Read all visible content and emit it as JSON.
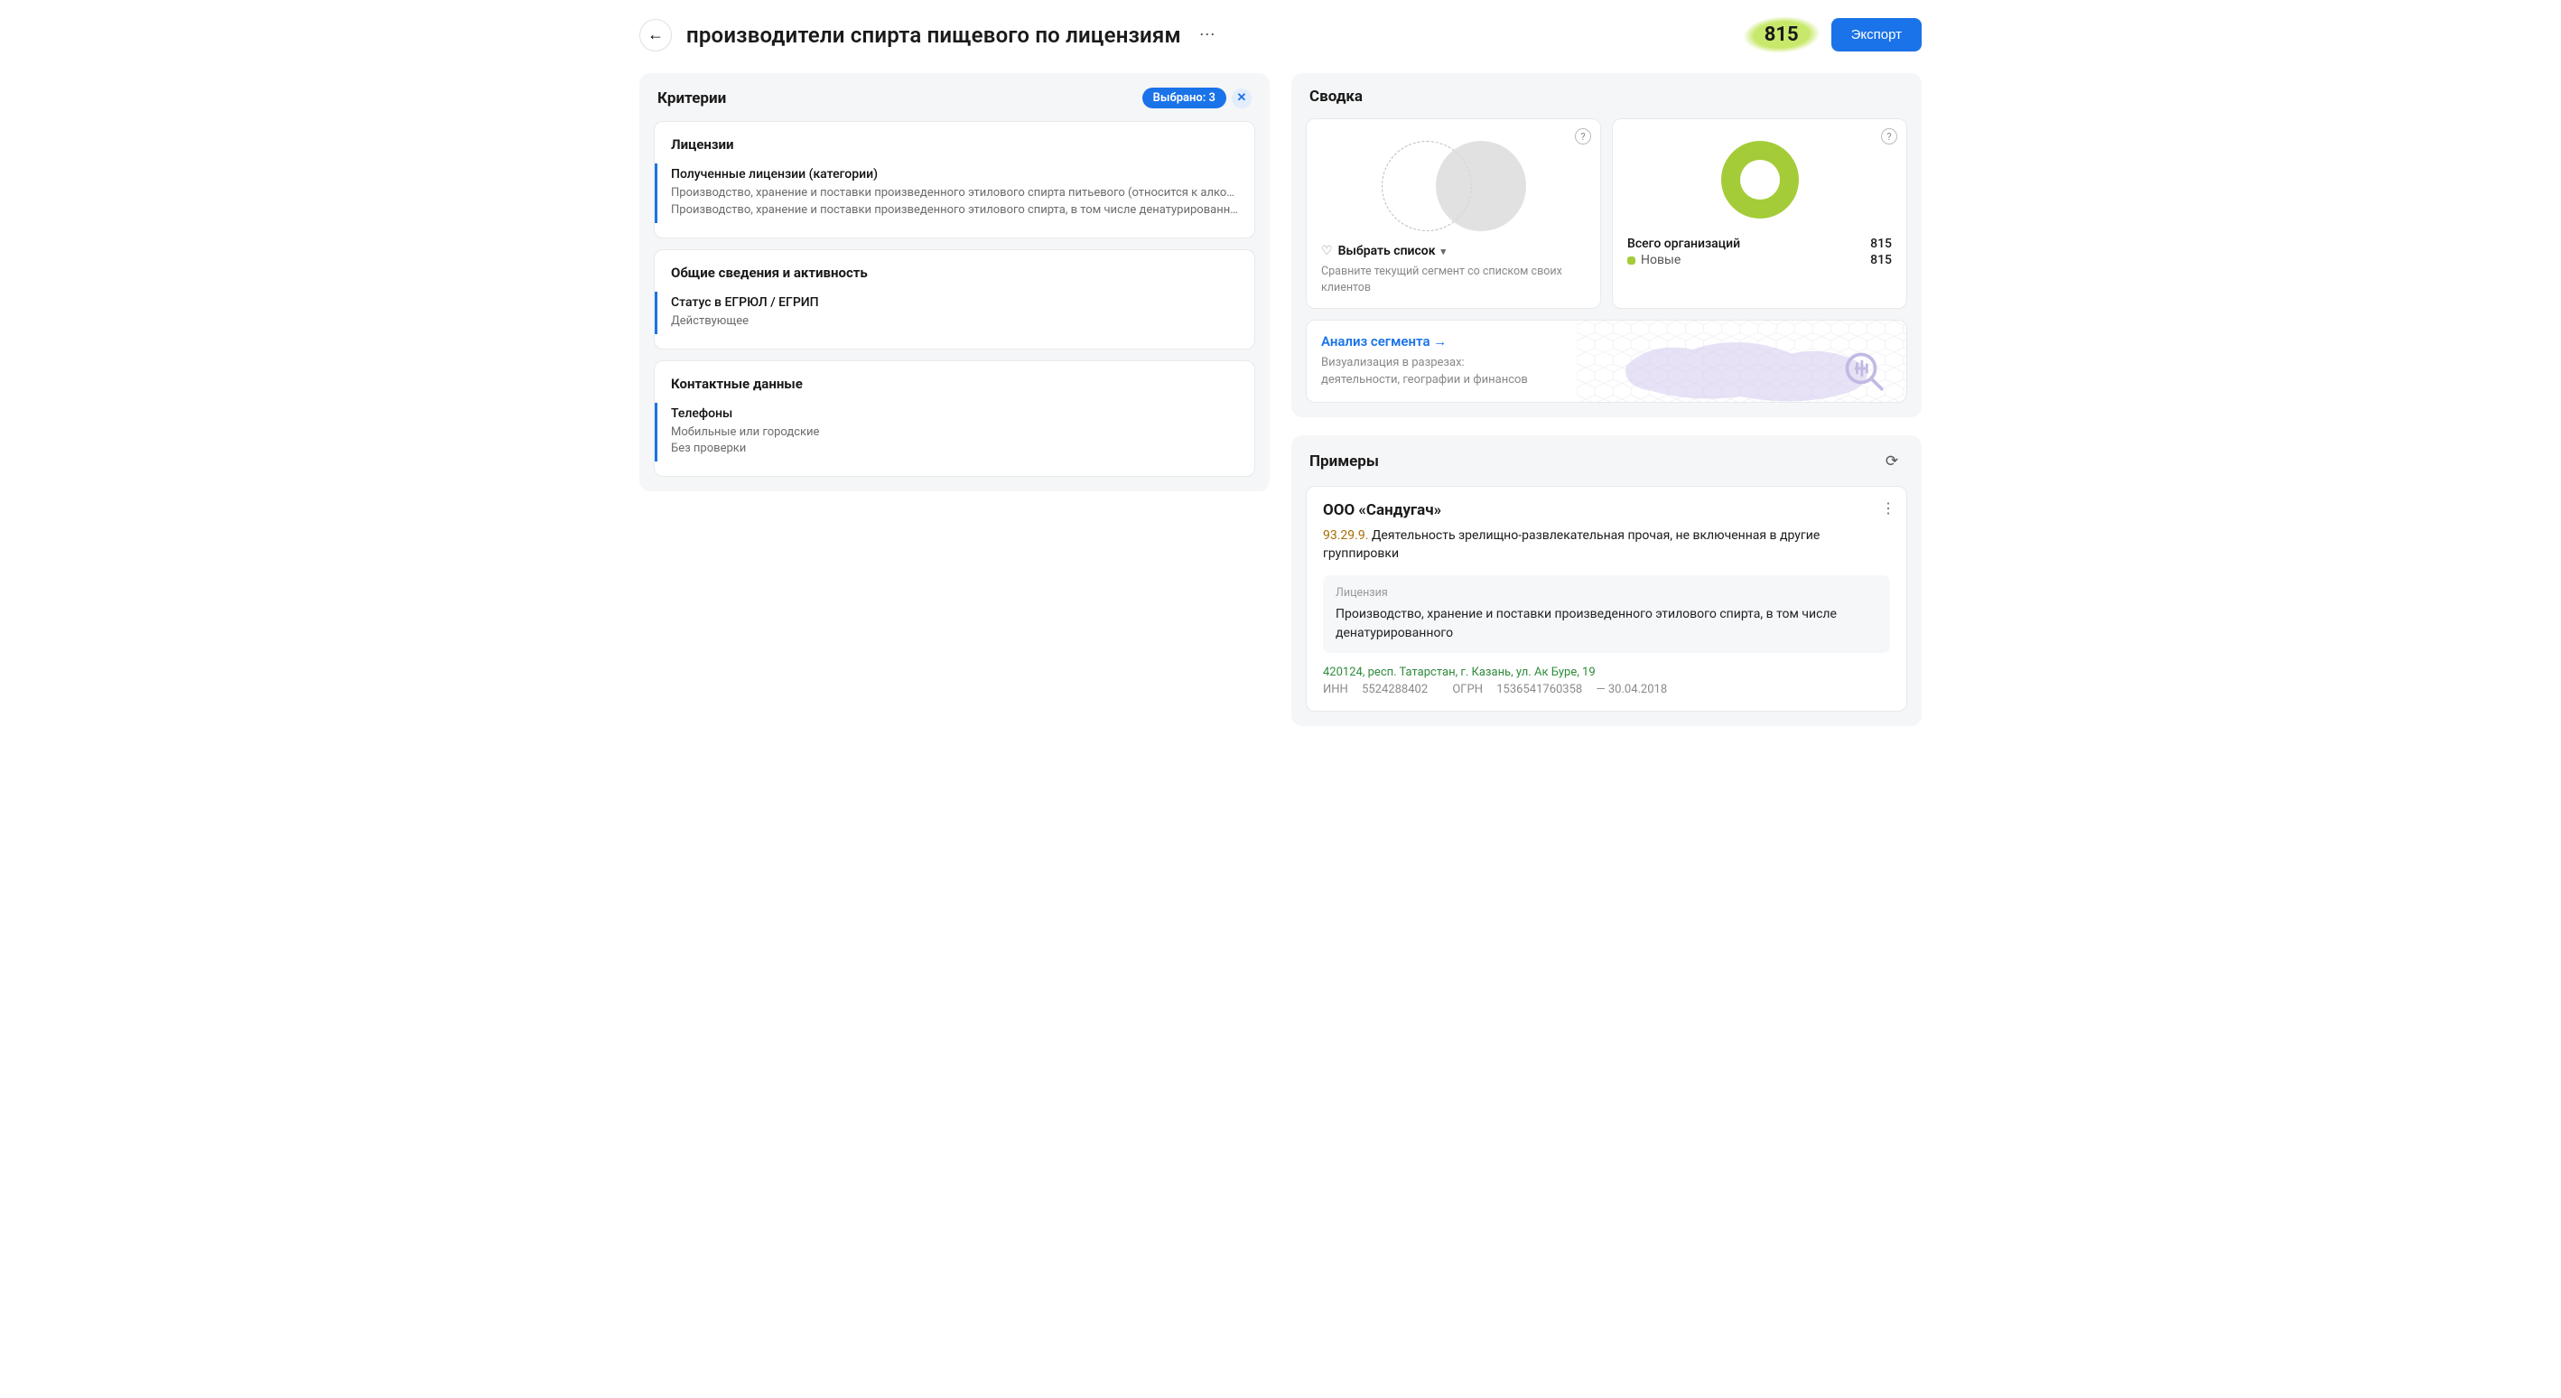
{
  "header": {
    "title": "производители спирта пищевого по лицензиям",
    "count": "815",
    "export_label": "Экспорт"
  },
  "criteria": {
    "heading": "Критерии",
    "selected_label": "Выбрано: 3",
    "groups": [
      {
        "title": "Лицензии",
        "items": [
          {
            "label": "Полученные лицензии (категории)",
            "values": [
              "Производство, хранение и поставки произведенного этилового спирта питьевого (относится к алкого…",
              "Производство, хранение и поставки произведенного этилового спирта, в том числе денатурированного"
            ]
          }
        ]
      },
      {
        "title": "Общие сведения и активность",
        "items": [
          {
            "label": "Статус в ЕГРЮЛ / ЕГРИП",
            "values": [
              "Действующее"
            ]
          }
        ]
      },
      {
        "title": "Контактные данные",
        "items": [
          {
            "label": "Телефоны",
            "values": [
              "Мобильные или городские",
              "Без проверки"
            ]
          }
        ]
      }
    ]
  },
  "summary": {
    "heading": "Сводка",
    "compare": {
      "select_label": "Выбрать список",
      "hint": "Сравните текущий сегмент со списком своих клиентов"
    },
    "totals": {
      "total_label": "Всего организаций",
      "total_value": "815",
      "new_label": "Новые",
      "new_value": "815"
    },
    "analysis": {
      "link_label": "Анализ сегмента",
      "desc": "Визуализация в разрезах:\nдеятельности, географии и финансов"
    }
  },
  "examples": {
    "heading": "Примеры",
    "org": {
      "name": "ООО «Сандугач»",
      "okved_code": "93.29.9.",
      "okved_text": " Деятельность зрелищно-развлекательная прочая, не включенная в другие группировки",
      "license_label": "Лицензия",
      "license_text": "Производство, хранение и поставки произведенного этилового спирта, в том числе денатурированного",
      "address": "420124, респ. Татарстан, г. Казань, ул. Ак Буре, 19",
      "inn_label": "ИНН",
      "inn": "5524288402",
      "ogrn_label": "ОГРН",
      "ogrn": "1536541760358",
      "reg_date": "30.04.2018"
    }
  },
  "chart_data": {
    "type": "pie",
    "title": "Всего организаций",
    "series": [
      {
        "name": "Новые",
        "value": 815,
        "color": "#a4cc38"
      }
    ],
    "total": 815
  }
}
